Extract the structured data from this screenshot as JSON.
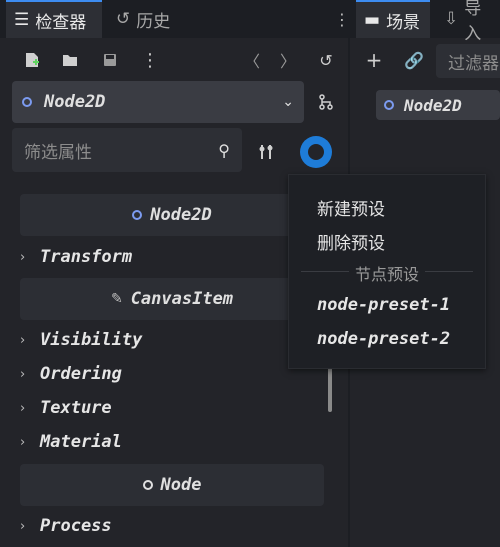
{
  "left_tabs": {
    "inspector_label": "检查器",
    "history_label": "历史"
  },
  "right_tabs": {
    "scene_label": "场景",
    "import_label": "导入"
  },
  "inspector": {
    "node_selector_value": "Node2D",
    "filter_placeholder": "筛选属性"
  },
  "sections": [
    {
      "label": "Node2D",
      "icon": "node2d-icon"
    },
    {
      "label": "CanvasItem",
      "icon": "pencil-icon"
    },
    {
      "label": "Node",
      "icon": "node-icon"
    }
  ],
  "properties": {
    "transform": "Transform",
    "visibility": "Visibility",
    "ordering": "Ordering",
    "texture": "Texture",
    "material": "Material",
    "process": "Process"
  },
  "popup": {
    "new_preset": "新建预设",
    "delete_preset": "删除预设",
    "section_label": "节点预设",
    "presets": [
      "node-preset-1",
      "node-preset-2"
    ]
  },
  "scene": {
    "filter_placeholder": "过滤器",
    "root_node": "Node2D"
  },
  "colors": {
    "accent": "#3d8cf0",
    "node2d_icon": "#7c9bf0",
    "preset_button": "#1e7cd8"
  }
}
